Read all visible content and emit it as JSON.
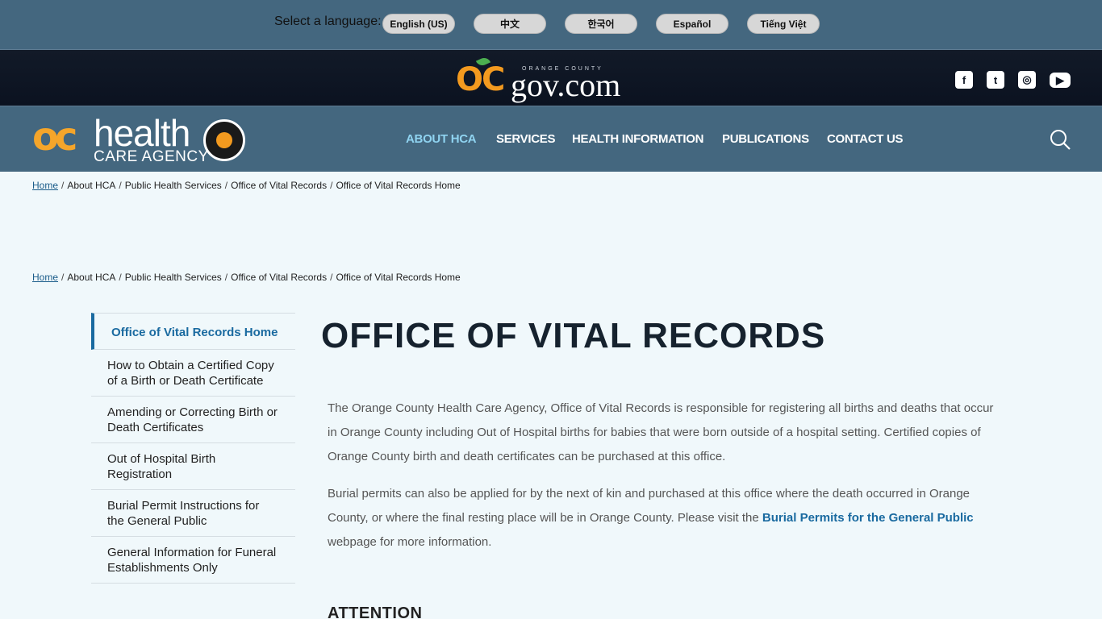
{
  "language": {
    "label": "Select a language:",
    "options": [
      "English (US)",
      "中文",
      "한국어",
      "Español",
      "Tiếng Việt"
    ]
  },
  "ocgov": {
    "logo_oc": "OC",
    "logo_county": "ORANGE COUNTY",
    "logo_gov": "gov.com"
  },
  "social": {
    "facebook": "f",
    "twitter": "t",
    "instagram": "◎",
    "youtube": "▶"
  },
  "hca_logo": {
    "oc": "oc",
    "health": "health",
    "care": "CARE AGENCY"
  },
  "nav": {
    "items": [
      "ABOUT HCA",
      "SERVICES",
      "HEALTH INFORMATION",
      "PUBLICATIONS",
      "CONTACT US"
    ]
  },
  "breadcrumb": {
    "home": "Home",
    "items": [
      "About HCA",
      "Public Health Services",
      "Office of Vital Records",
      "Office of Vital Records Home"
    ],
    "separator": "/"
  },
  "sidebar": {
    "items": [
      "Office of Vital Records Home",
      "How to Obtain a Certified Copy of a Birth or Death Certificate",
      "Amending or Correcting Birth or Death Certificates",
      "Out of Hospital Birth Registration",
      "Burial Permit Instructions for the General Public",
      "General Information for Funeral Establishments Only"
    ]
  },
  "main": {
    "title": "OFFICE OF VITAL RECORDS",
    "para1": "The Orange County Health Care Agency, Office of Vital Records is responsible for registering all births and deaths that occur in Orange County including Out of Hospital births for babies that were born outside of a hospital setting.  Certified copies of Orange County birth and death certificates can be purchased at this office.",
    "para2_before": "Burial permits can also be applied for by the next of kin and purchased at this office where the death occurred in Orange County, or where the final resting place will be in Orange County.  Please visit the ",
    "para2_link": "Burial Permits for the General Public",
    "para2_after": " webpage for more information.",
    "attention": "ATTENTION"
  }
}
